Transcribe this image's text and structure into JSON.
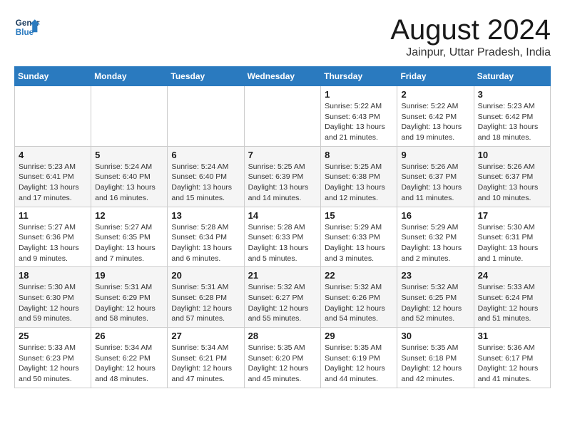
{
  "header": {
    "logo_general": "General",
    "logo_blue": "Blue",
    "month_year": "August 2024",
    "location": "Jainpur, Uttar Pradesh, India"
  },
  "calendar": {
    "headers": [
      "Sunday",
      "Monday",
      "Tuesday",
      "Wednesday",
      "Thursday",
      "Friday",
      "Saturday"
    ],
    "weeks": [
      {
        "days": [
          {
            "num": "",
            "info": ""
          },
          {
            "num": "",
            "info": ""
          },
          {
            "num": "",
            "info": ""
          },
          {
            "num": "",
            "info": ""
          },
          {
            "num": "1",
            "info": "Sunrise: 5:22 AM\nSunset: 6:43 PM\nDaylight: 13 hours\nand 21 minutes."
          },
          {
            "num": "2",
            "info": "Sunrise: 5:22 AM\nSunset: 6:42 PM\nDaylight: 13 hours\nand 19 minutes."
          },
          {
            "num": "3",
            "info": "Sunrise: 5:23 AM\nSunset: 6:42 PM\nDaylight: 13 hours\nand 18 minutes."
          }
        ]
      },
      {
        "days": [
          {
            "num": "4",
            "info": "Sunrise: 5:23 AM\nSunset: 6:41 PM\nDaylight: 13 hours\nand 17 minutes."
          },
          {
            "num": "5",
            "info": "Sunrise: 5:24 AM\nSunset: 6:40 PM\nDaylight: 13 hours\nand 16 minutes."
          },
          {
            "num": "6",
            "info": "Sunrise: 5:24 AM\nSunset: 6:40 PM\nDaylight: 13 hours\nand 15 minutes."
          },
          {
            "num": "7",
            "info": "Sunrise: 5:25 AM\nSunset: 6:39 PM\nDaylight: 13 hours\nand 14 minutes."
          },
          {
            "num": "8",
            "info": "Sunrise: 5:25 AM\nSunset: 6:38 PM\nDaylight: 13 hours\nand 12 minutes."
          },
          {
            "num": "9",
            "info": "Sunrise: 5:26 AM\nSunset: 6:37 PM\nDaylight: 13 hours\nand 11 minutes."
          },
          {
            "num": "10",
            "info": "Sunrise: 5:26 AM\nSunset: 6:37 PM\nDaylight: 13 hours\nand 10 minutes."
          }
        ]
      },
      {
        "days": [
          {
            "num": "11",
            "info": "Sunrise: 5:27 AM\nSunset: 6:36 PM\nDaylight: 13 hours\nand 9 minutes."
          },
          {
            "num": "12",
            "info": "Sunrise: 5:27 AM\nSunset: 6:35 PM\nDaylight: 13 hours\nand 7 minutes."
          },
          {
            "num": "13",
            "info": "Sunrise: 5:28 AM\nSunset: 6:34 PM\nDaylight: 13 hours\nand 6 minutes."
          },
          {
            "num": "14",
            "info": "Sunrise: 5:28 AM\nSunset: 6:33 PM\nDaylight: 13 hours\nand 5 minutes."
          },
          {
            "num": "15",
            "info": "Sunrise: 5:29 AM\nSunset: 6:33 PM\nDaylight: 13 hours\nand 3 minutes."
          },
          {
            "num": "16",
            "info": "Sunrise: 5:29 AM\nSunset: 6:32 PM\nDaylight: 13 hours\nand 2 minutes."
          },
          {
            "num": "17",
            "info": "Sunrise: 5:30 AM\nSunset: 6:31 PM\nDaylight: 13 hours\nand 1 minute."
          }
        ]
      },
      {
        "days": [
          {
            "num": "18",
            "info": "Sunrise: 5:30 AM\nSunset: 6:30 PM\nDaylight: 12 hours\nand 59 minutes."
          },
          {
            "num": "19",
            "info": "Sunrise: 5:31 AM\nSunset: 6:29 PM\nDaylight: 12 hours\nand 58 minutes."
          },
          {
            "num": "20",
            "info": "Sunrise: 5:31 AM\nSunset: 6:28 PM\nDaylight: 12 hours\nand 57 minutes."
          },
          {
            "num": "21",
            "info": "Sunrise: 5:32 AM\nSunset: 6:27 PM\nDaylight: 12 hours\nand 55 minutes."
          },
          {
            "num": "22",
            "info": "Sunrise: 5:32 AM\nSunset: 6:26 PM\nDaylight: 12 hours\nand 54 minutes."
          },
          {
            "num": "23",
            "info": "Sunrise: 5:32 AM\nSunset: 6:25 PM\nDaylight: 12 hours\nand 52 minutes."
          },
          {
            "num": "24",
            "info": "Sunrise: 5:33 AM\nSunset: 6:24 PM\nDaylight: 12 hours\nand 51 minutes."
          }
        ]
      },
      {
        "days": [
          {
            "num": "25",
            "info": "Sunrise: 5:33 AM\nSunset: 6:23 PM\nDaylight: 12 hours\nand 50 minutes."
          },
          {
            "num": "26",
            "info": "Sunrise: 5:34 AM\nSunset: 6:22 PM\nDaylight: 12 hours\nand 48 minutes."
          },
          {
            "num": "27",
            "info": "Sunrise: 5:34 AM\nSunset: 6:21 PM\nDaylight: 12 hours\nand 47 minutes."
          },
          {
            "num": "28",
            "info": "Sunrise: 5:35 AM\nSunset: 6:20 PM\nDaylight: 12 hours\nand 45 minutes."
          },
          {
            "num": "29",
            "info": "Sunrise: 5:35 AM\nSunset: 6:19 PM\nDaylight: 12 hours\nand 44 minutes."
          },
          {
            "num": "30",
            "info": "Sunrise: 5:35 AM\nSunset: 6:18 PM\nDaylight: 12 hours\nand 42 minutes."
          },
          {
            "num": "31",
            "info": "Sunrise: 5:36 AM\nSunset: 6:17 PM\nDaylight: 12 hours\nand 41 minutes."
          }
        ]
      }
    ]
  }
}
